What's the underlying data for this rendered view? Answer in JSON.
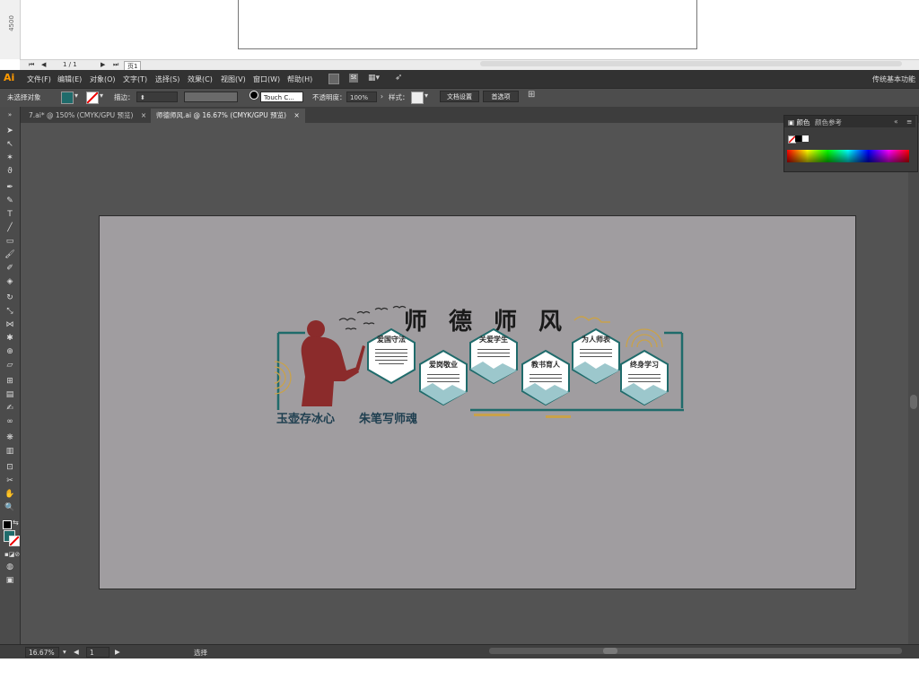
{
  "top_doc": {
    "ruler_value": "4500",
    "page_count": "1 / 1",
    "page_tab": "页1"
  },
  "menu": {
    "logo": "Ai",
    "items": [
      "文件(F)",
      "编辑(E)",
      "对象(O)",
      "文字(T)",
      "选择(S)",
      "效果(C)",
      "视图(V)",
      "窗口(W)",
      "帮助(H)"
    ],
    "workspace": "传统基本功能"
  },
  "control": {
    "selection_status": "未选择对象",
    "stroke_label": "描边：",
    "brush_name": "Touch C...",
    "opacity_label": "不透明度：",
    "opacity_value": "100%",
    "style_label": "样式：",
    "doc_setup": "文档设置",
    "preferences": "首选项"
  },
  "tabs": [
    {
      "label": "7.ai* @ 150% (CMYK/GPU 预览)",
      "active": false
    },
    {
      "label": "师德师风.ai @ 16.67% (CMYK/GPU 预览)",
      "active": true
    }
  ],
  "panel": {
    "tab_color": "颜色",
    "tab_guide": "颜色参考"
  },
  "status": {
    "zoom": "16.67%",
    "artboard": "1",
    "tool": "选择"
  },
  "artwork": {
    "title_chars": [
      "师",
      "德",
      "师",
      "风"
    ],
    "slogan_left": "玉壶存冰心",
    "slogan_right": "朱笔写师魂",
    "hexes": [
      {
        "label": "爱国守法"
      },
      {
        "label": "爱岗敬业"
      },
      {
        "label": "关爱学生"
      },
      {
        "label": "教书育人"
      },
      {
        "label": "为人师表"
      },
      {
        "label": "终身学习"
      }
    ]
  },
  "colors": {
    "accent_teal": "#1f6b6b",
    "figure_red": "#8b2b2b",
    "gold": "#c9a24a",
    "artboard": "#a09da0"
  }
}
